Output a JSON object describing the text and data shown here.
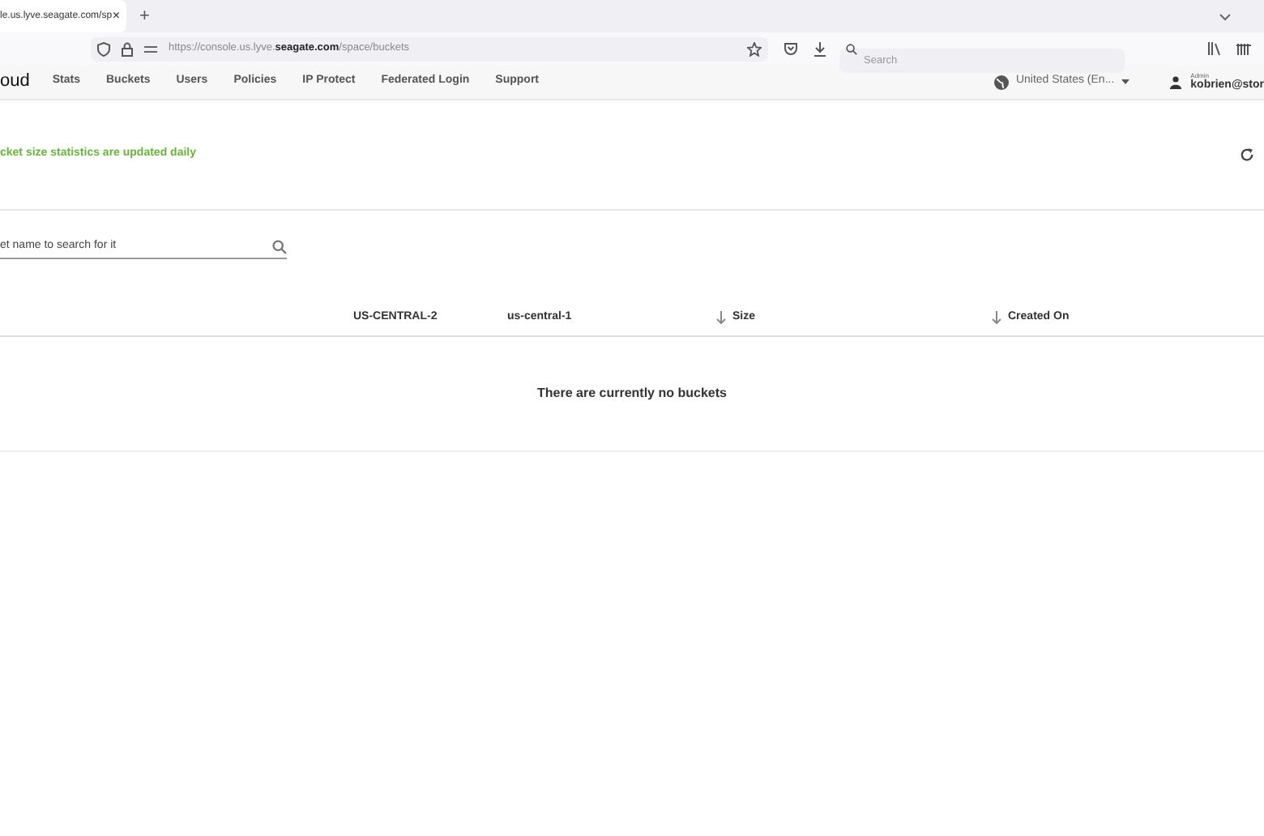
{
  "browser": {
    "tab_title": "le.us.lyve.seagate.com/sp",
    "tab_close": "×",
    "new_tab": "+",
    "url": "https://console.us.lyve.**seagate.com**/space/buckets",
    "search_placeholder": "Search"
  },
  "app_nav": {
    "logo": "oud",
    "items": [
      "Stats",
      "Buckets",
      "Users",
      "Policies",
      "IP Protect",
      "Federated Login",
      "Support"
    ],
    "language": "United States (En...",
    "role": "Admin",
    "user": "kobrien@stor"
  },
  "notice": "cket size statistics are updated daily",
  "search": {
    "placeholder": "et name to search for it"
  },
  "table": {
    "columns": [
      {
        "label": "US-CENTRAL-2",
        "sortable": false
      },
      {
        "label": "us-central-1",
        "sortable": false
      },
      {
        "label": "Size",
        "sortable": true
      },
      {
        "label": "Created On",
        "sortable": true
      }
    ],
    "empty_message": "There are currently no buckets"
  }
}
